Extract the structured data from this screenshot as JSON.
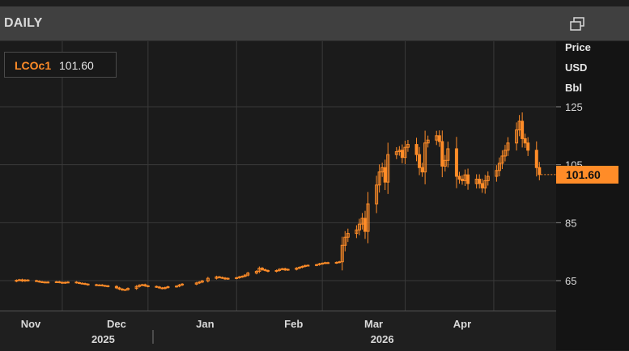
{
  "header": {
    "title": "DAILY",
    "popout_icon": "popout-window-icon"
  },
  "legend": {
    "ric": "LCOc1",
    "value": "101.60"
  },
  "axis": {
    "title_line1": "Price",
    "title_line2": "USD",
    "title_line3": "Bbl"
  },
  "last_price_tag": "101.60",
  "colors": {
    "series": "#ff8c28",
    "grid": "#3a3a3a",
    "background": "#1b1b1b"
  },
  "chart_data": {
    "type": "candlestick",
    "series_name": "LCOc1",
    "unit": "USD/Bbl",
    "last_value": 101.6,
    "y_ticks": [
      65,
      85,
      105,
      125
    ],
    "ylim": [
      57,
      137
    ],
    "month_labels": [
      "Nov",
      "Dec",
      "Jan",
      "Feb",
      "Mar",
      "Apr"
    ],
    "year_labels": [
      "2025",
      "2026"
    ],
    "grid": true,
    "x": [
      "2025-10-27",
      "2025-10-28",
      "2025-10-29",
      "2025-10-30",
      "2025-10-31",
      "2025-11-03",
      "2025-11-04",
      "2025-11-05",
      "2025-11-06",
      "2025-11-07",
      "2025-11-10",
      "2025-11-11",
      "2025-11-12",
      "2025-11-13",
      "2025-11-14",
      "2025-11-17",
      "2025-11-18",
      "2025-11-19",
      "2025-11-20",
      "2025-11-21",
      "2025-11-24",
      "2025-11-25",
      "2025-11-26",
      "2025-11-27",
      "2025-11-28",
      "2025-12-01",
      "2025-12-02",
      "2025-12-03",
      "2025-12-04",
      "2025-12-05",
      "2025-12-08",
      "2025-12-09",
      "2025-12-10",
      "2025-12-11",
      "2025-12-12",
      "2025-12-15",
      "2025-12-16",
      "2025-12-17",
      "2025-12-18",
      "2025-12-19",
      "2025-12-22",
      "2025-12-23",
      "2025-12-24",
      "2025-12-29",
      "2025-12-30",
      "2025-12-31",
      "2026-01-02",
      "2026-01-05",
      "2026-01-06",
      "2026-01-07",
      "2026-01-08",
      "2026-01-09",
      "2026-01-12",
      "2026-01-13",
      "2026-01-14",
      "2026-01-15",
      "2026-01-16",
      "2026-01-19",
      "2026-01-20",
      "2026-01-21",
      "2026-01-22",
      "2026-01-23",
      "2026-01-26",
      "2026-01-27",
      "2026-01-28",
      "2026-01-29",
      "2026-01-30",
      "2026-02-02",
      "2026-02-03",
      "2026-02-04",
      "2026-02-05",
      "2026-02-06",
      "2026-02-09",
      "2026-02-10",
      "2026-02-11",
      "2026-02-12",
      "2026-02-13",
      "2026-02-16",
      "2026-02-17",
      "2026-02-18",
      "2026-02-19",
      "2026-02-20",
      "2026-02-23",
      "2026-02-24",
      "2026-02-25",
      "2026-02-26",
      "2026-02-27",
      "2026-03-02",
      "2026-03-03",
      "2026-03-04",
      "2026-03-05",
      "2026-03-06",
      "2026-03-09",
      "2026-03-10",
      "2026-03-11",
      "2026-03-12",
      "2026-03-13",
      "2026-03-16",
      "2026-03-17",
      "2026-03-18",
      "2026-03-19",
      "2026-03-20",
      "2026-03-23",
      "2026-03-24",
      "2026-03-25",
      "2026-03-26",
      "2026-03-27",
      "2026-03-30",
      "2026-03-31",
      "2026-04-01",
      "2026-04-02",
      "2026-04-03",
      "2026-04-06",
      "2026-04-07",
      "2026-04-08",
      "2026-04-09",
      "2026-04-10",
      "2026-04-13",
      "2026-04-14",
      "2026-04-15",
      "2026-04-16",
      "2026-04-17",
      "2026-04-20",
      "2026-04-21",
      "2026-04-22",
      "2026-04-23",
      "2026-04-24",
      "2026-04-27",
      "2026-04-28"
    ],
    "close": [
      65.1,
      65.3,
      64.9,
      65.2,
      65.0,
      64.8,
      64.6,
      64.5,
      64.4,
      64.5,
      64.6,
      64.4,
      64.2,
      64.4,
      64.5,
      64.3,
      64.1,
      64.0,
      63.8,
      63.6,
      63.4,
      63.5,
      63.3,
      63.2,
      63.0,
      62.5,
      62.1,
      61.8,
      61.9,
      62.3,
      63.0,
      63.4,
      63.6,
      63.2,
      63.0,
      62.8,
      62.5,
      62.3,
      62.6,
      62.9,
      63.1,
      63.5,
      63.8,
      64.2,
      64.5,
      64.9,
      65.8,
      66.3,
      66.1,
      65.9,
      65.6,
      65.8,
      66.0,
      66.3,
      66.5,
      66.9,
      67.6,
      68.2,
      69.3,
      68.8,
      68.5,
      68.2,
      68.5,
      68.9,
      69.1,
      68.7,
      68.9,
      69.3,
      69.6,
      69.9,
      70.2,
      70.3,
      70.5,
      70.8,
      71.0,
      71.2,
      71.1,
      71.3,
      71.5,
      77.2,
      80.0,
      81.3,
      82.5,
      84.5,
      86.5,
      82.0,
      91.5,
      98.0,
      102.5,
      104.0,
      99.0,
      108.5,
      109.5,
      110.0,
      107.5,
      111.0,
      112.0,
      108.5,
      104.0,
      102.5,
      112.5,
      113.5,
      115.0,
      113.0,
      104.5,
      106.5,
      110.5,
      101.0,
      100.0,
      99.5,
      101.5,
      98.5,
      100.0,
      98.5,
      97.0,
      99.5,
      101.0,
      103.0,
      105.5,
      108.0,
      110.0,
      112.5,
      117.0,
      120.0,
      114.0,
      112.5,
      110.0,
      104.0,
      101.6
    ]
  }
}
